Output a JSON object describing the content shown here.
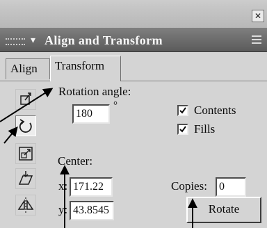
{
  "panel": {
    "title": "Align and Transform",
    "close_icon": "close-icon",
    "menu_icon": "options-menu-icon"
  },
  "tabs": [
    {
      "label": "Align",
      "active": false
    },
    {
      "label": "Transform",
      "active": true
    }
  ],
  "tools": [
    {
      "name": "position-tool-icon",
      "selected": false
    },
    {
      "name": "rotate-tool-icon",
      "selected": true
    },
    {
      "name": "scale-tool-icon",
      "selected": false
    },
    {
      "name": "skew-tool-icon",
      "selected": false
    },
    {
      "name": "reflect-tool-icon",
      "selected": false
    }
  ],
  "transform": {
    "rotation_label": "Rotation angle:",
    "rotation_value": "180",
    "degree_symbol": "°",
    "contents_label": "Contents",
    "contents_checked": true,
    "fills_label": "Fills",
    "fills_checked": true,
    "center_label": "Center:",
    "x_label": "x:",
    "x_value": "171.22",
    "y_label": "y:",
    "y_value": "43.8545",
    "copies_label": "Copies:",
    "copies_value": "0",
    "rotate_button": "Rotate"
  }
}
